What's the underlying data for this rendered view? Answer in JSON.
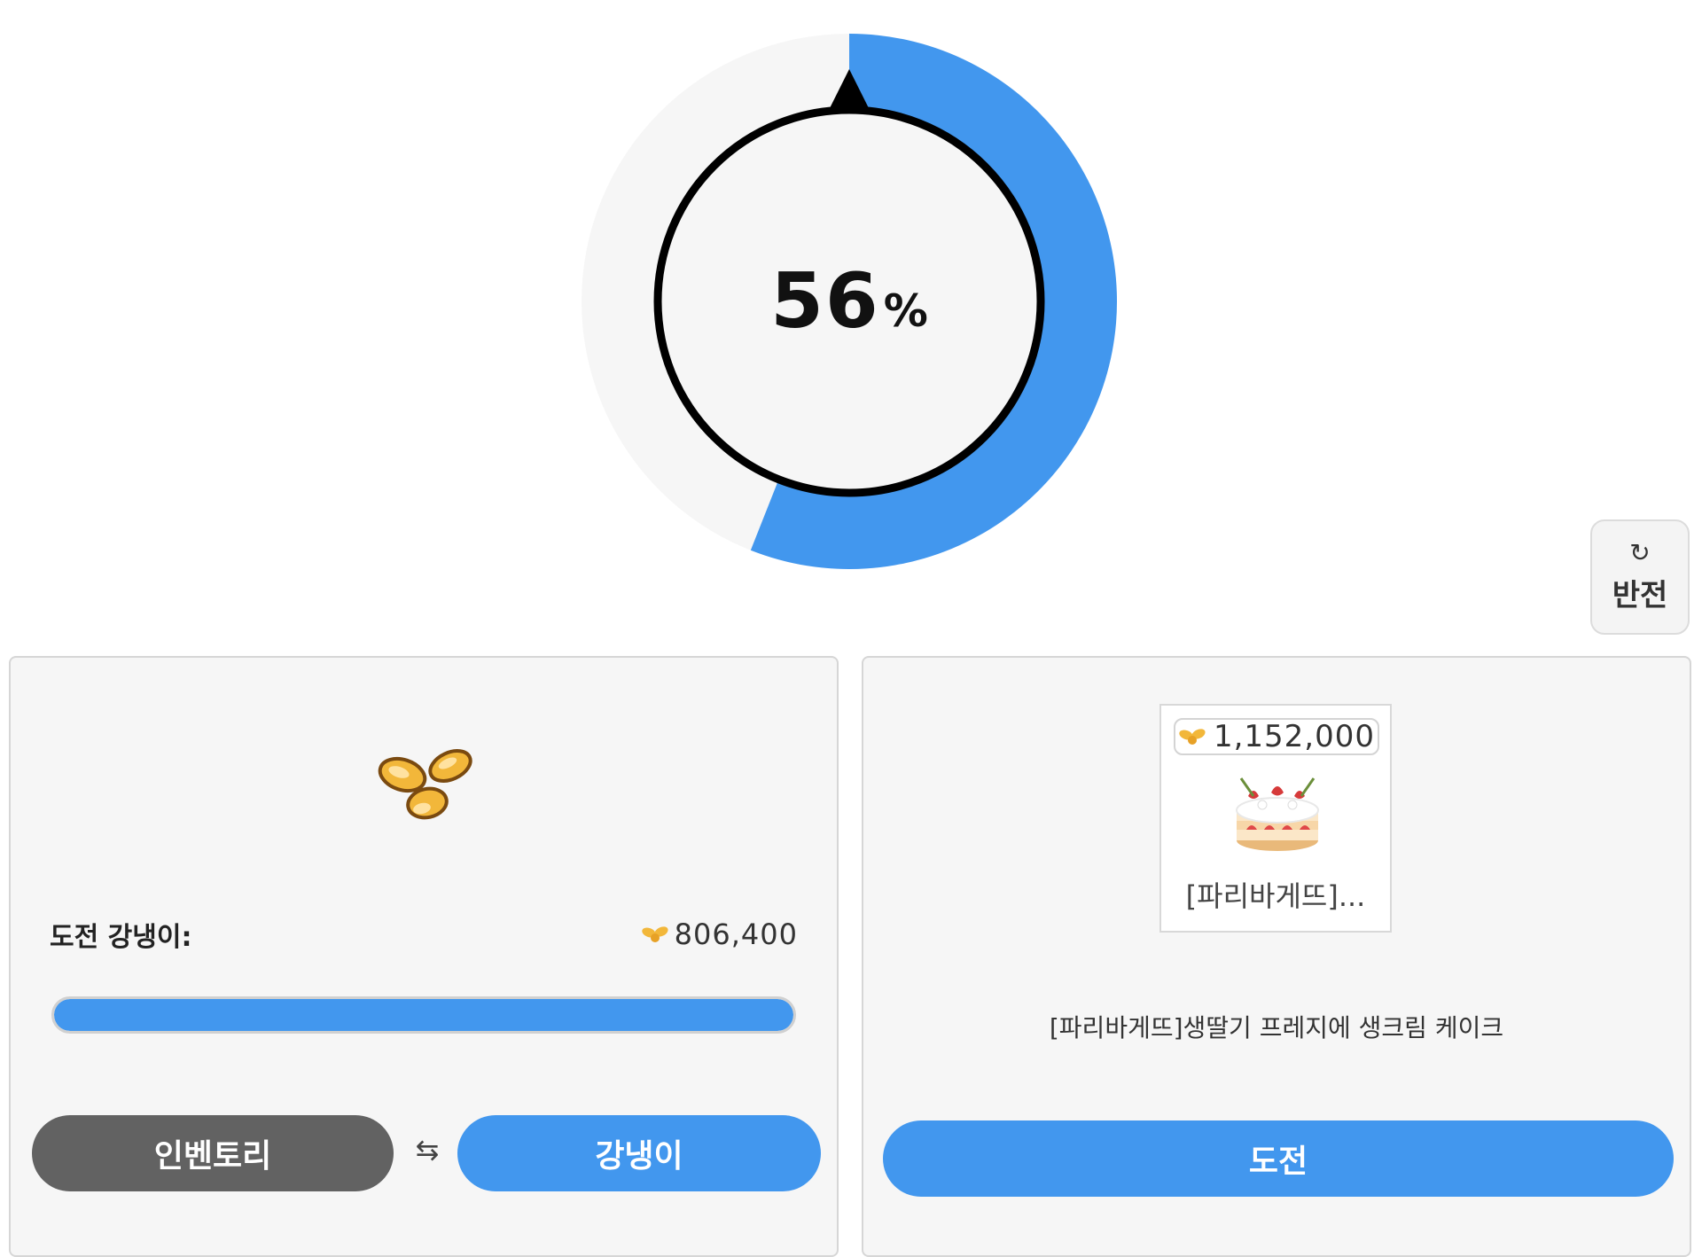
{
  "gauge": {
    "value": "56",
    "unit": "%",
    "fraction": 0.56,
    "fill_color": "#4297EE",
    "track_color": "#F6F6F6"
  },
  "flip_button": {
    "icon": "refresh-icon",
    "label": "반전"
  },
  "left_panel": {
    "item_icon": "kernel-icon",
    "challenge_label": "도전 강냉이:",
    "amount_icon": "kernel-icon",
    "amount": "806,400",
    "progress": 1.0,
    "progress_color": "#4297EE",
    "inventory_button": "인벤토리",
    "swap_icon": "swap-arrows-icon",
    "kernel_button": "강냉이"
  },
  "right_panel": {
    "prize_price_icon": "kernel-icon",
    "prize_price": "1,152,000",
    "prize_image": "strawberry-cake",
    "prize_short_name": "[파리바게뜨]...",
    "prize_full_name": "[파리바게뜨]생딸기 프레지에 생크림 케이크",
    "challenge_button": "도전"
  },
  "colors": {
    "accent": "#4297EE",
    "dark_button": "#626262",
    "panel_bg": "#F6F6F6"
  }
}
